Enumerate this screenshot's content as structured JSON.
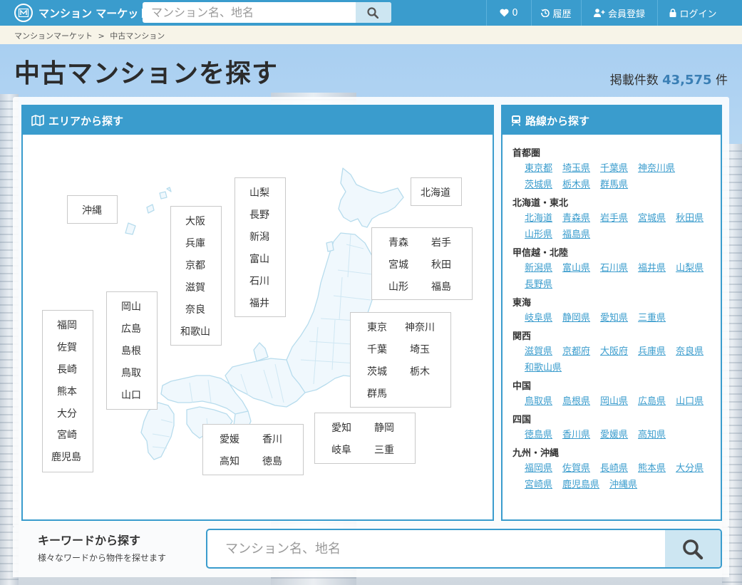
{
  "header": {
    "logo_text": "マンション マーケット",
    "search_placeholder": "マンション名、地名",
    "nav": {
      "favorites_count": "0",
      "history_label": "履歴",
      "register_label": "会員登録",
      "login_label": "ログイン"
    }
  },
  "breadcrumb": [
    "マンションマーケット",
    "中古マンション"
  ],
  "breadcrumb_sep": ">",
  "page_title": "中古マンションを探す",
  "listing": {
    "label": "掲載件数",
    "count": "43,575",
    "unit": "件"
  },
  "area_panel": {
    "title": "エリアから探す",
    "regions": [
      {
        "id": "okinawa",
        "prefs": [
          "沖縄"
        ]
      },
      {
        "id": "kyushu",
        "prefs": [
          "福岡",
          "佐賀",
          "長崎",
          "熊本",
          "大分",
          "宮崎",
          "鹿児島"
        ]
      },
      {
        "id": "chugoku",
        "prefs": [
          "岡山",
          "広島",
          "島根",
          "鳥取",
          "山口"
        ]
      },
      {
        "id": "kansai",
        "prefs": [
          "大阪",
          "兵庫",
          "京都",
          "滋賀",
          "奈良",
          "和歌山"
        ]
      },
      {
        "id": "koshinetsu",
        "prefs": [
          "山梨",
          "長野",
          "新潟",
          "富山",
          "石川",
          "福井"
        ]
      },
      {
        "id": "hokkaido",
        "prefs": [
          "北海道"
        ]
      },
      {
        "id": "tohoku",
        "prefs": [
          "青森",
          "岩手",
          "宮城",
          "秋田",
          "山形",
          "福島"
        ]
      },
      {
        "id": "kanto",
        "prefs": [
          "東京",
          "神奈川",
          "千葉",
          "埼玉",
          "茨城",
          "栃木",
          "群馬"
        ]
      },
      {
        "id": "tokai",
        "prefs": [
          "愛知",
          "静岡",
          "岐阜",
          "三重"
        ]
      },
      {
        "id": "shikoku",
        "prefs": [
          "愛媛",
          "香川",
          "高知",
          "徳島"
        ]
      }
    ]
  },
  "line_panel": {
    "title": "路線から探す",
    "groups": [
      {
        "title": "首都圏",
        "links": [
          "東京都",
          "埼玉県",
          "千葉県",
          "神奈川県",
          "茨城県",
          "栃木県",
          "群馬県"
        ]
      },
      {
        "title": "北海道・東北",
        "links": [
          "北海道",
          "青森県",
          "岩手県",
          "宮城県",
          "秋田県",
          "山形県",
          "福島県"
        ]
      },
      {
        "title": "甲信越・北陸",
        "links": [
          "新潟県",
          "富山県",
          "石川県",
          "福井県",
          "山梨県",
          "長野県"
        ]
      },
      {
        "title": "東海",
        "links": [
          "岐阜県",
          "静岡県",
          "愛知県",
          "三重県"
        ]
      },
      {
        "title": "関西",
        "links": [
          "滋賀県",
          "京都府",
          "大阪府",
          "兵庫県",
          "奈良県",
          "和歌山県"
        ]
      },
      {
        "title": "中国",
        "links": [
          "鳥取県",
          "島根県",
          "岡山県",
          "広島県",
          "山口県"
        ]
      },
      {
        "title": "四国",
        "links": [
          "徳島県",
          "香川県",
          "愛媛県",
          "高知県"
        ]
      },
      {
        "title": "九州・沖縄",
        "links": [
          "福岡県",
          "佐賀県",
          "長崎県",
          "熊本県",
          "大分県",
          "宮崎県",
          "鹿児島県",
          "沖縄県"
        ]
      }
    ]
  },
  "keyword_search": {
    "title": "キーワードから探す",
    "subtitle": "様々なワードから物件を探せます",
    "placeholder": "マンション名、地名"
  },
  "colors": {
    "primary": "#3a9ccd",
    "button_bg": "#cde6f2",
    "link": "#3a9ccd",
    "breadcrumb_bg": "#f7f4e8"
  }
}
